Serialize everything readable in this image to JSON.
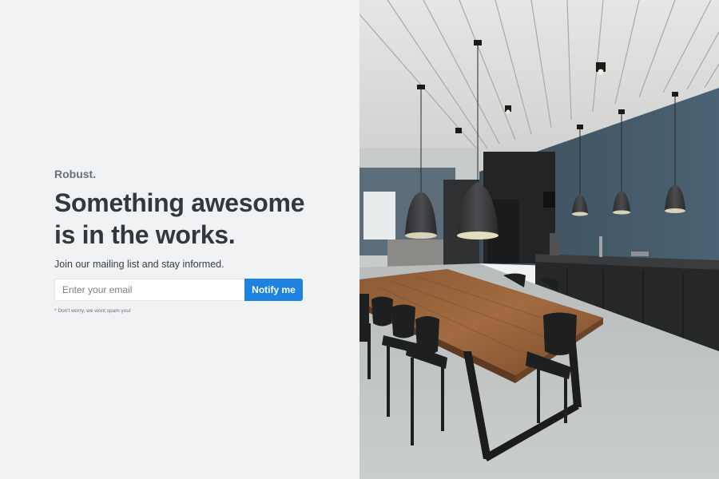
{
  "brand": "Robust.",
  "headline_line1": "Something awesome",
  "headline_line2": "is in the works.",
  "subtitle": "Join our mailing list and stay informed.",
  "email": {
    "placeholder": "Enter your email",
    "value": ""
  },
  "notify_button": "Notify me",
  "disclaimer": "* Don't worry, we wont spam you!",
  "colors": {
    "accent": "#1d82e0",
    "background": "#f1f2f4",
    "text": "#34383d"
  }
}
